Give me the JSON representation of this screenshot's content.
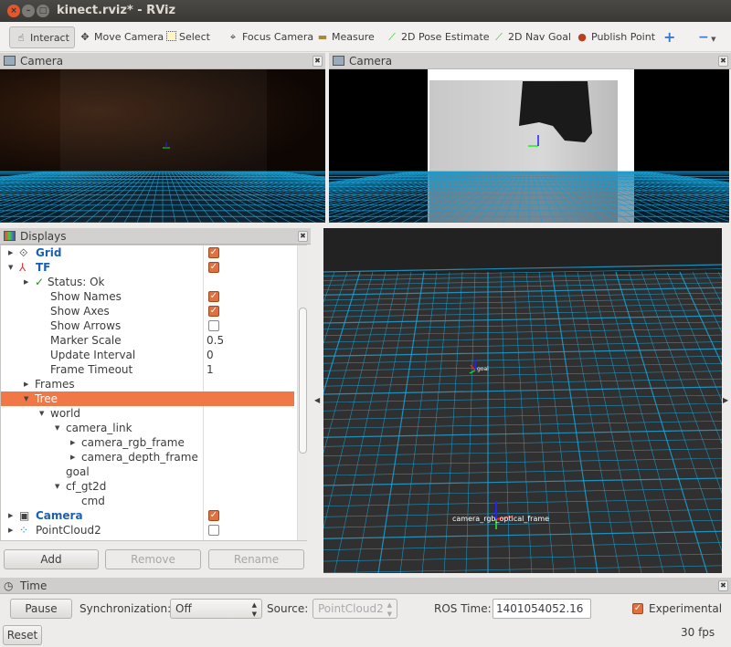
{
  "window": {
    "title": "kinect.rviz* - RViz"
  },
  "toolbar": {
    "tools": [
      {
        "label": "Interact",
        "icon": "hand-icon",
        "active": true
      },
      {
        "label": "Move Camera",
        "icon": "move-icon"
      },
      {
        "label": "Select",
        "icon": "select-icon"
      },
      {
        "label": "Focus Camera",
        "icon": "focus-icon"
      },
      {
        "label": "Measure",
        "icon": "ruler-icon"
      },
      {
        "label": "2D Pose Estimate",
        "icon": "green-arrow-icon"
      },
      {
        "label": "2D Nav Goal",
        "icon": "green-arrow-icon"
      },
      {
        "label": "Publish Point",
        "icon": "map-pin-icon"
      }
    ]
  },
  "camera_panels": [
    {
      "title": "Camera"
    },
    {
      "title": "Camera"
    }
  ],
  "displays": {
    "title": "Displays",
    "rows": [
      {
        "label": "Grid",
        "indent": 0,
        "arrow": "right",
        "icon": "grid-icon",
        "bold": true,
        "check": true
      },
      {
        "label": "TF",
        "indent": 0,
        "arrow": "down",
        "icon": "tf-icon",
        "bold": true,
        "check": true
      },
      {
        "label": "Status: Ok",
        "indent": 1,
        "arrow": "right",
        "icon": "check-icon"
      },
      {
        "label": "Show Names",
        "indent": 2,
        "check": true
      },
      {
        "label": "Show Axes",
        "indent": 2,
        "check": true
      },
      {
        "label": "Show Arrows",
        "indent": 2,
        "check": false
      },
      {
        "label": "Marker Scale",
        "indent": 2,
        "value": "0.5"
      },
      {
        "label": "Update Interval",
        "indent": 2,
        "value": "0"
      },
      {
        "label": "Frame Timeout",
        "indent": 2,
        "value": "1"
      },
      {
        "label": "Frames",
        "indent": 1,
        "arrow": "right"
      },
      {
        "label": "Tree",
        "indent": 1,
        "arrow": "down",
        "selected": true
      },
      {
        "label": "world",
        "indent": 2,
        "arrow": "down"
      },
      {
        "label": "camera_link",
        "indent": 3,
        "arrow": "down"
      },
      {
        "label": "camera_rgb_frame",
        "indent": 4,
        "arrow": "right"
      },
      {
        "label": "camera_depth_frame",
        "indent": 4,
        "arrow": "right"
      },
      {
        "label": "goal",
        "indent": 3
      },
      {
        "label": "cf_gt2d",
        "indent": 3,
        "arrow": "down"
      },
      {
        "label": "cmd",
        "indent": 4
      },
      {
        "label": "Camera",
        "indent": 0,
        "arrow": "right",
        "icon": "camera-icon",
        "bold": true,
        "check": true
      },
      {
        "label": "PointCloud2",
        "indent": 0,
        "arrow": "right",
        "icon": "pointcloud-icon",
        "check": false
      }
    ],
    "buttons": {
      "add": "Add",
      "remove": "Remove",
      "rename": "Rename"
    }
  },
  "viewport": {
    "labels": {
      "goal": "goal",
      "frame": "camera_rgb_optical_frame"
    },
    "grid_color": "#1aa3d6",
    "background": "#303030"
  },
  "time": {
    "title": "Time",
    "pause": "Pause",
    "sync_label": "Synchronization:",
    "sync_value": "Off",
    "source_label": "Source:",
    "source_value": "PointCloud2",
    "ros_time_label": "ROS Time:",
    "ros_time_value": "1401054052.16",
    "experimental_label": "Experimental",
    "experimental_checked": true,
    "reset": "Reset",
    "fps": "30 fps"
  },
  "colors": {
    "accent": "#f07746",
    "link": "#1a5fb4"
  }
}
